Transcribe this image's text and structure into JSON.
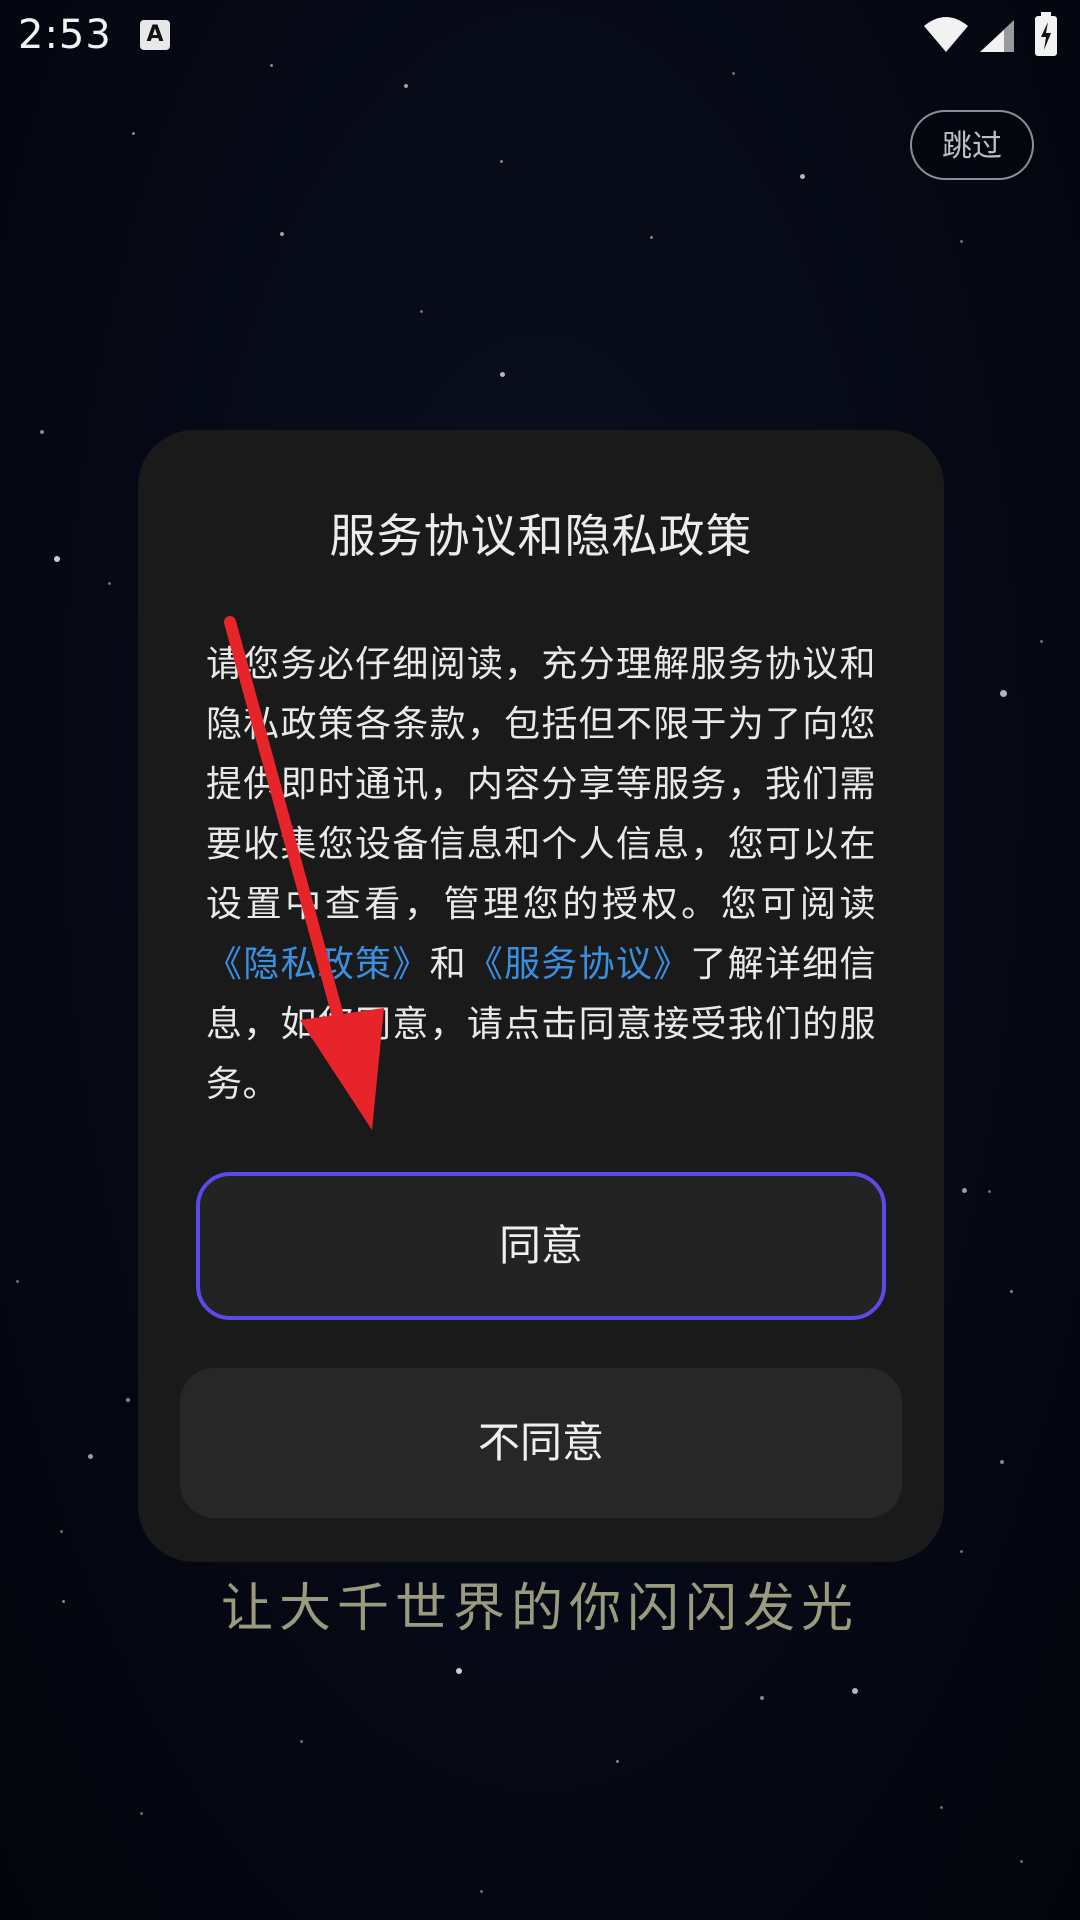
{
  "status_bar": {
    "time": "2:53",
    "keyboard_indicator": "A",
    "icons": [
      "wifi-icon",
      "cell-signal-icon",
      "battery-charging-icon"
    ]
  },
  "header": {
    "skip_label": "跳过"
  },
  "dialog": {
    "title": "服务协议和隐私政策",
    "body_part1": "请您务必仔细阅读，充分理解服务协议和隐私政策各条款，包括但不限于为了向您提供即时通讯，内容分享等服务，我们需要收集您设备信息和个人信息，您可以在设置中查看，管理您的授权。您可阅读",
    "privacy_link": "《隐私政策》",
    "body_and": "和",
    "service_link": "《服务协议》",
    "body_part2": "了解详细信息，如您同意，请点击同意接受我们的服务。",
    "agree_label": "同意",
    "disagree_label": "不同意"
  },
  "slogan": "让大千世界的你闪闪发光",
  "colors": {
    "accent_border": "#5b4ae8",
    "link": "#3b8fe0",
    "annotation_arrow": "#e8242b",
    "dialog_bg": "#1a1a1a"
  }
}
